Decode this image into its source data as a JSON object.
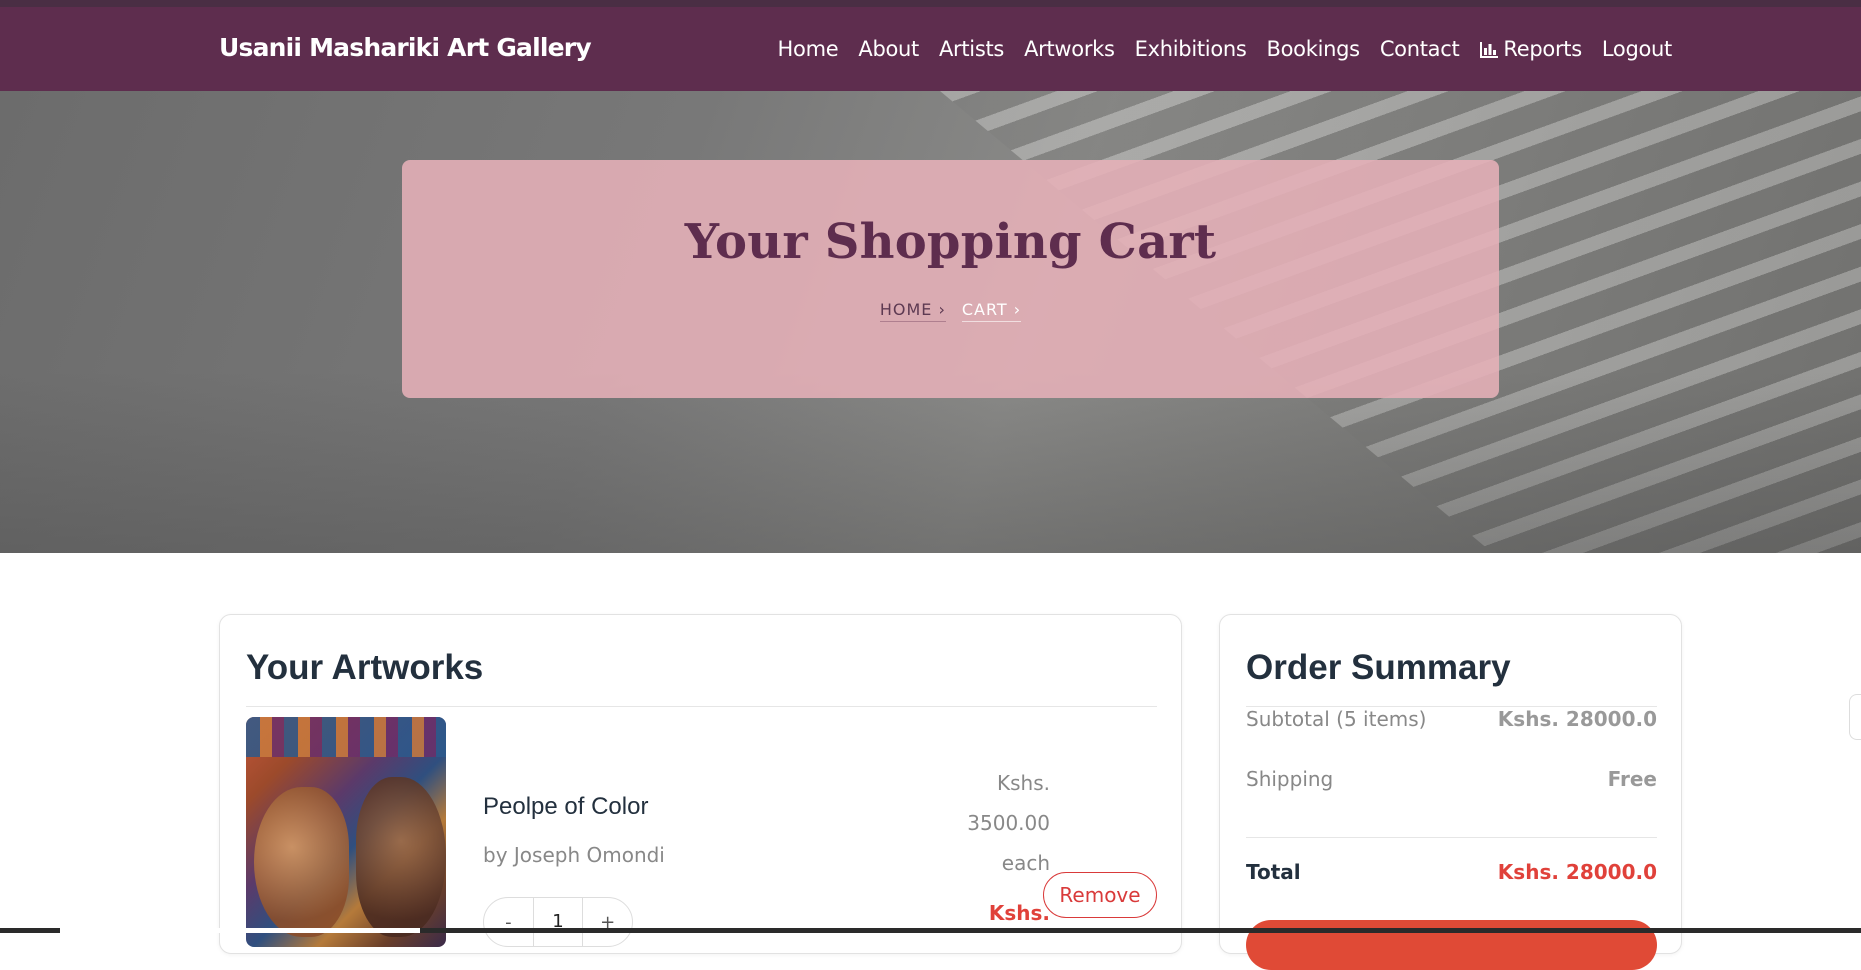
{
  "brand": "Usanii Mashariki Art Gallery",
  "nav": {
    "home": "Home",
    "about": "About",
    "artists": "Artists",
    "artworks": "Artworks",
    "exhibitions": "Exhibitions",
    "bookings": "Bookings",
    "contact": "Contact",
    "reports": "Reports",
    "reports_icon": "bar-chart-icon",
    "logout": "Logout"
  },
  "hero": {
    "title": "Your Shopping Cart",
    "breadcrumb": [
      "HOME ›",
      "CART ›"
    ]
  },
  "artworks": {
    "title": "Your Artworks",
    "items": [
      {
        "name": "Peolpe of Color",
        "artist": "by Joseph Omondi",
        "unit_price_lines": [
          "Kshs.",
          "3500.00",
          "each"
        ],
        "line_total": "Kshs.",
        "quantity": "1",
        "minus": "-",
        "plus": "+",
        "remove_label": "Remove"
      }
    ]
  },
  "summary": {
    "title": "Order Summary",
    "subtotal_label": "Subtotal (5 items)",
    "subtotal_value": "Kshs. 28000.0",
    "shipping_label": "Shipping",
    "shipping_value": "Free",
    "total_label": "Total",
    "total_value": "Kshs. 28000.0"
  },
  "colors": {
    "navbar": "#5e2d4e",
    "hero_card": "#e6b0b8",
    "accent_red": "#e0413a"
  }
}
